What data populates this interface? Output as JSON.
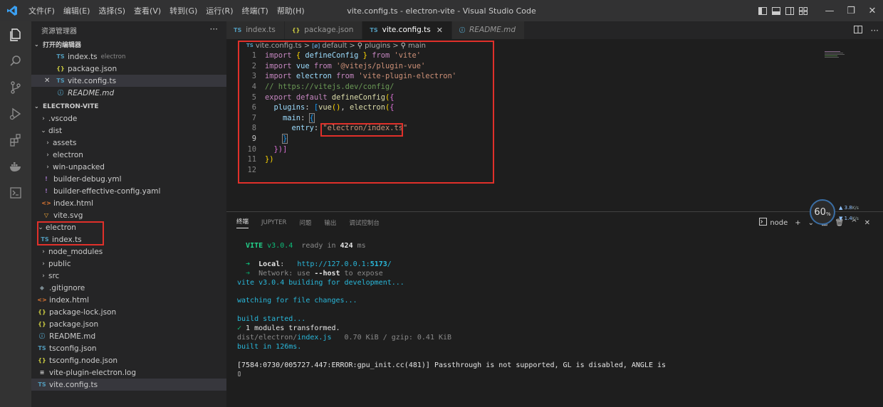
{
  "window": {
    "title": "vite.config.ts - electron-vite - Visual Studio Code",
    "menu": [
      "文件(F)",
      "编辑(E)",
      "选择(S)",
      "查看(V)",
      "转到(G)",
      "运行(R)",
      "终端(T)",
      "帮助(H)"
    ],
    "controls": {
      "minimize": "—",
      "restore": "❐",
      "close": "✕"
    }
  },
  "sidebar": {
    "title": "资源管理器",
    "more": "···",
    "open_editors_label": "打开的编辑器",
    "open_editors": [
      {
        "name": "index.ts",
        "icon": "TS",
        "desc": "electron",
        "close": ""
      },
      {
        "name": "package.json",
        "icon": "{}",
        "desc": "",
        "close": ""
      },
      {
        "name": "vite.config.ts",
        "icon": "TS",
        "desc": "",
        "close": "✕"
      },
      {
        "name": "README.md",
        "icon": "ⓘ",
        "desc": "",
        "close": ""
      }
    ],
    "project_label": "ELECTRON-VITE",
    "tree": [
      {
        "name": ".vscode",
        "twisty": "›",
        "icon": ""
      },
      {
        "name": "dist",
        "twisty": "⌄",
        "icon": ""
      },
      {
        "name": "assets",
        "twisty": "›",
        "icon": ""
      },
      {
        "name": "electron",
        "twisty": "›",
        "icon": ""
      },
      {
        "name": "win-unpacked",
        "twisty": "›",
        "icon": ""
      },
      {
        "name": "builder-debug.yml",
        "twisty": "",
        "icon": "!"
      },
      {
        "name": "builder-effective-config.yaml",
        "twisty": "",
        "icon": "!"
      },
      {
        "name": "index.html",
        "twisty": "",
        "icon": "<>"
      },
      {
        "name": "vite.svg",
        "twisty": "",
        "icon": "▽"
      },
      {
        "name": "electron",
        "twisty": "⌄",
        "icon": ""
      },
      {
        "name": "index.ts",
        "twisty": "",
        "icon": "TS"
      },
      {
        "name": "node_modules",
        "twisty": "›",
        "icon": ""
      },
      {
        "name": "public",
        "twisty": "›",
        "icon": ""
      },
      {
        "name": "src",
        "twisty": "›",
        "icon": ""
      },
      {
        "name": ".gitignore",
        "twisty": "",
        "icon": "◆"
      },
      {
        "name": "index.html",
        "twisty": "",
        "icon": "<>"
      },
      {
        "name": "package-lock.json",
        "twisty": "",
        "icon": "{}"
      },
      {
        "name": "package.json",
        "twisty": "",
        "icon": "{}"
      },
      {
        "name": "README.md",
        "twisty": "",
        "icon": "ⓘ"
      },
      {
        "name": "tsconfig.json",
        "twisty": "",
        "icon": "TS"
      },
      {
        "name": "tsconfig.node.json",
        "twisty": "",
        "icon": "{}"
      },
      {
        "name": "vite-plugin-electron.log",
        "twisty": "",
        "icon": "≡"
      },
      {
        "name": "vite.config.ts",
        "twisty": "",
        "icon": "TS"
      }
    ]
  },
  "tabs": [
    {
      "label": "index.ts",
      "icon": "TS"
    },
    {
      "label": "package.json",
      "icon": "{}"
    },
    {
      "label": "vite.config.ts",
      "icon": "TS",
      "close": "✕"
    },
    {
      "label": "README.md",
      "icon": "ⓘ"
    }
  ],
  "breadcrumb": {
    "file": "vite.config.ts",
    "sep": ">",
    "parts": [
      "default",
      "plugins",
      "main"
    ],
    "markers": [
      "[ø]",
      "⚲",
      "⚲"
    ]
  },
  "code": {
    "line_numbers": [
      "1",
      "2",
      "3",
      "4",
      "5",
      "6",
      "7",
      "8",
      "9",
      "10",
      "11",
      "12"
    ],
    "l1": {
      "kw": "import",
      "b1": "{",
      "id": " defineConfig ",
      "b2": "}",
      "from": "from",
      "str": "'vite'"
    },
    "l2": {
      "kw": "import",
      "id": "vue",
      "from": "from",
      "str": "'@vitejs/plugin-vue'"
    },
    "l3": {
      "kw": "import",
      "id": "electron",
      "from": "from",
      "str": "'vite-plugin-electron'"
    },
    "l4": {
      "comment": "// https://vitejs.dev/config/"
    },
    "l5": {
      "kw": "export",
      "kw2": "default",
      "fn": "defineConfig",
      "paren": "(",
      "brace": "{"
    },
    "l6": {
      "prop": "plugins",
      "colon": ":",
      "lb": "[",
      "fn1": "vue",
      "call": "()",
      "comma": ",",
      "fn2": "electron",
      "paren": "(",
      "brace": "{"
    },
    "l7": {
      "prop": "main",
      "colon": ":",
      "brace": "{"
    },
    "l8": {
      "prop": "entry",
      "colon": ":",
      "str": "\"electron/index.ts\""
    },
    "l9": {
      "brace": "}"
    },
    "l10": {
      "text": "})]"
    },
    "l11": {
      "text": "})"
    }
  },
  "panel": {
    "tabs": [
      "终端",
      "JUPYTER",
      "问题",
      "输出",
      "调试控制台"
    ],
    "shell": "node",
    "actions": [
      "+",
      "⌄",
      "▥",
      "🗑",
      "^",
      "✕"
    ]
  },
  "terminal": {
    "vite_name": "VITE",
    "vite_ver": " v3.0.4",
    "ready": "  ready in ",
    "ready_ms": "424",
    "ready_unit": " ms",
    "local_arrow": "➜",
    "local_label": "Local",
    "local_colon": ":   ",
    "local_url_a": "http://127.0.0.1:",
    "local_url_port": "5173",
    "local_url_b": "/",
    "network_arrow": "➜",
    "network_label": "Network",
    "network_text": ": use ",
    "network_flag": "--host",
    "network_tail": " to expose",
    "building": "vite v3.0.4 building for development...",
    "watching": "watching for file changes...",
    "build_started": "build started...",
    "check": "✓",
    "transformed": " 1 modules transformed.",
    "out_dir": "dist/electron/",
    "out_file": "index.js",
    "out_size": "   0.70 KiB / gzip: 0.41 KiB",
    "built": "built in 126ms.",
    "error": "[7584:0730/005727.447:ERROR:gpu_init.cc(481)] Passthrough is not supported, GL is disabled, ANGLE is",
    "cursor": "▯"
  },
  "fps_widget": {
    "value": "60",
    "unit": "%",
    "up": "3.8",
    "up_unit": "K/s",
    "down": "1.4",
    "down_unit": "K/s"
  },
  "colors": {
    "accent": "#007acc",
    "highlight_box": "#e0302a",
    "sidebar_bg": "#252526",
    "editor_bg": "#1e1e1e"
  }
}
